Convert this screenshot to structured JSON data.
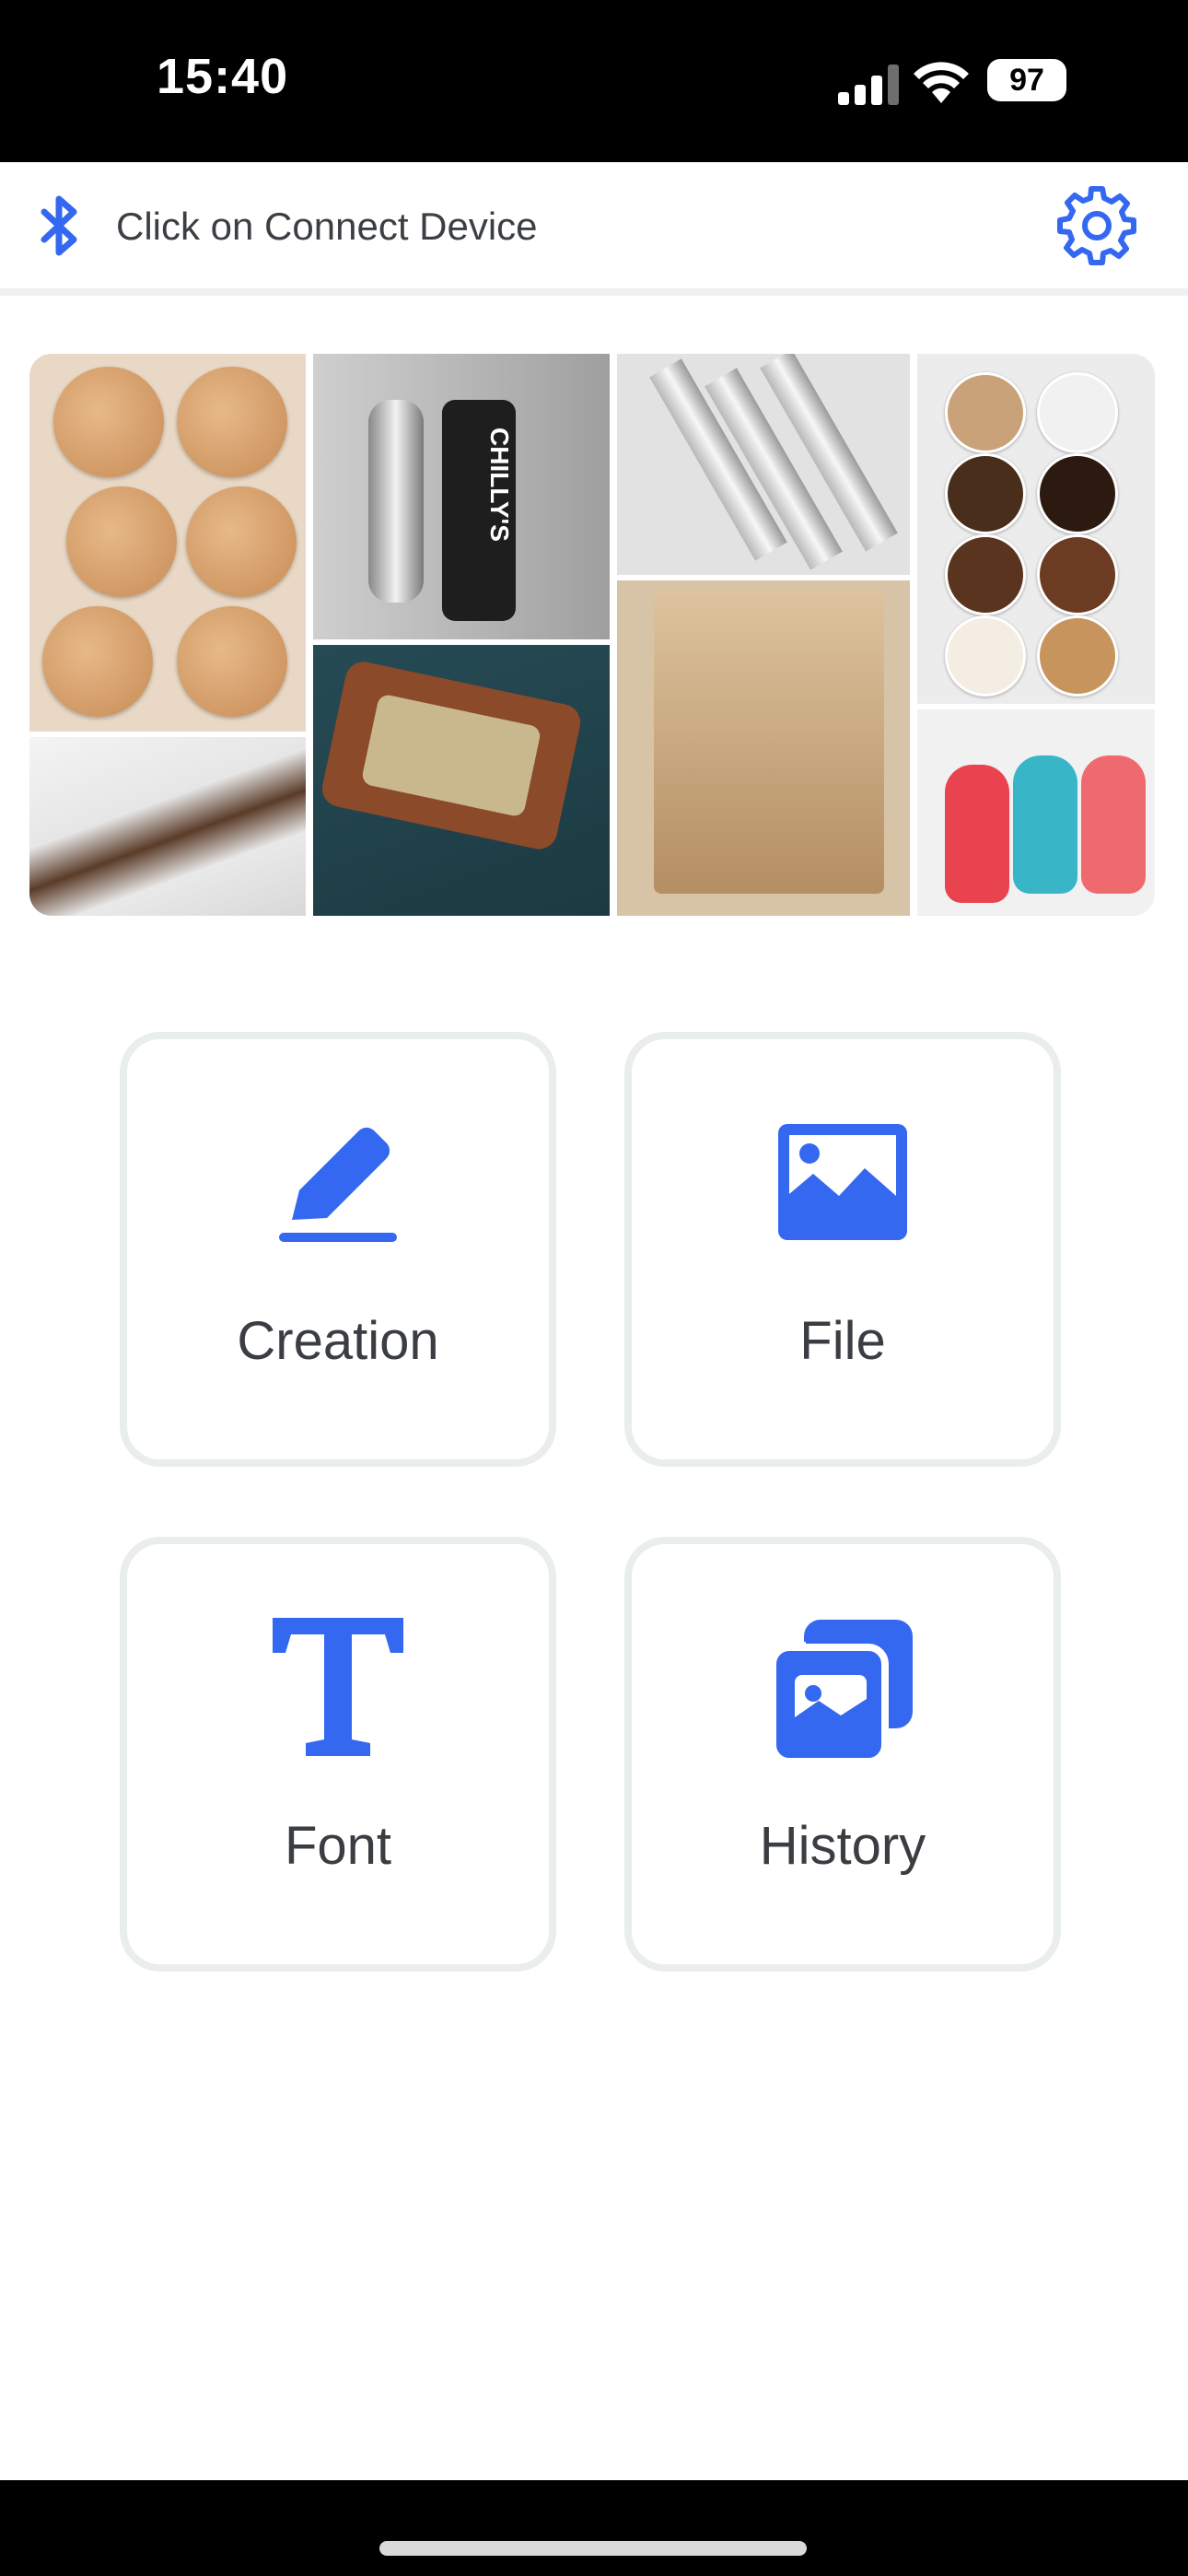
{
  "status_bar": {
    "time": "15:40",
    "battery": "97",
    "icons": [
      "signal-icon",
      "wifi-icon",
      "battery-icon"
    ]
  },
  "header": {
    "connect_label": "Click on Connect Device",
    "icons": [
      "bluetooth-icon",
      "gear-icon"
    ]
  },
  "banner": {
    "image_subjects": [
      "wooden-coasters",
      "shoe",
      "bottle",
      "keychain",
      "pens",
      "portrait-engraving",
      "badges",
      "motel-keychains"
    ],
    "bottle_text": "CHILLY'S"
  },
  "menu": {
    "items": [
      {
        "label": "Creation",
        "icon": "pencil-icon"
      },
      {
        "label": "File",
        "icon": "image-icon"
      },
      {
        "label": "Font",
        "icon": "text-t-icon"
      },
      {
        "label": "History",
        "icon": "gallery-stack-icon"
      }
    ]
  },
  "colors": {
    "accent": "#3468f0",
    "card_border": "#e9edee",
    "text": "#3a3d41"
  }
}
